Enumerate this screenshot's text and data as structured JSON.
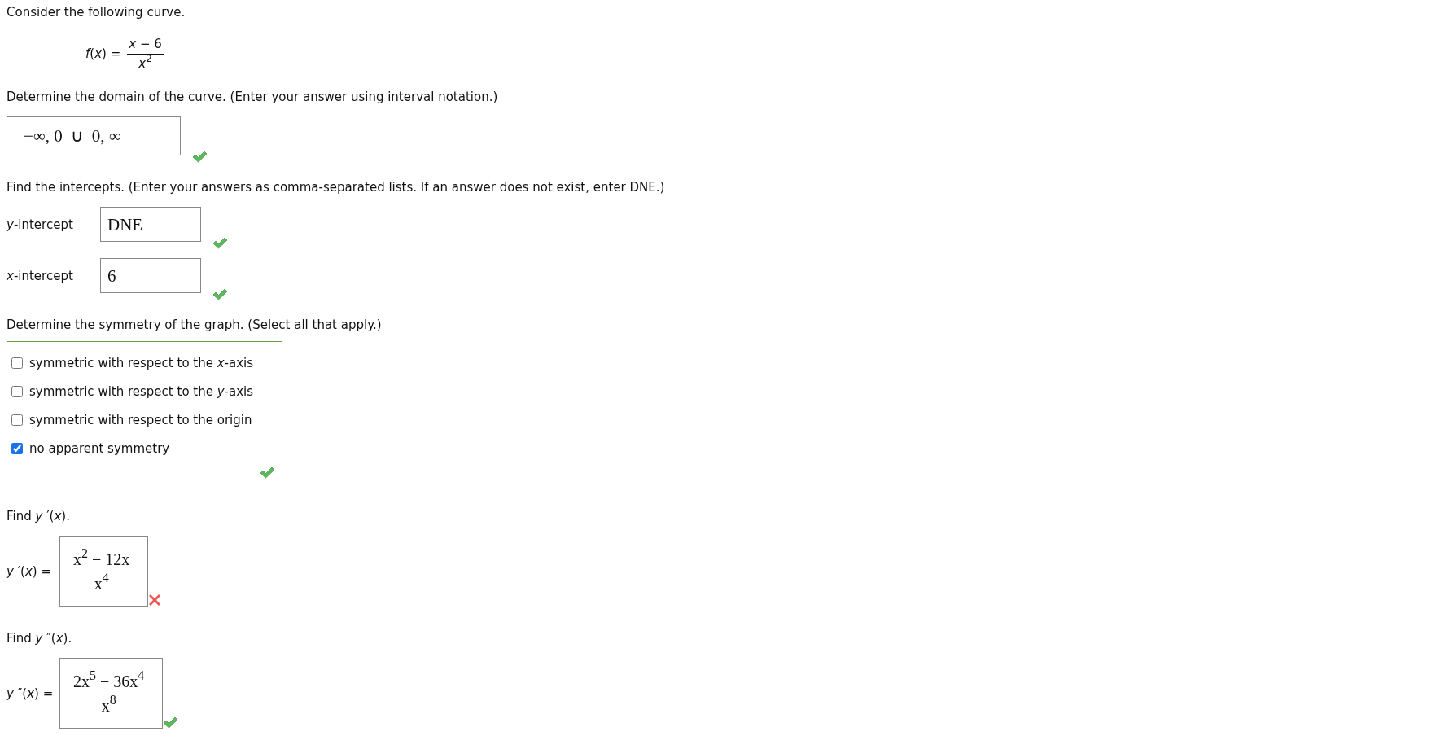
{
  "intro": "Consider the following curve.",
  "function": {
    "label": "*f*(*x*) =",
    "numerator": "*x* − 6",
    "denominator": "*x*$^{2}$"
  },
  "questions": [
    {
      "kind": "interval",
      "prompt": "Determine the domain of the curve. (Enter your answer using interval notation.)",
      "answer": "−∞, 0  ∪  0, ∞",
      "correct": true
    },
    {
      "kind": "fields",
      "prompt": "Find the intercepts. (Enter your answers as comma-separated lists. If an answer does not exist, enter DNE.)",
      "fields": [
        {
          "label": "*y*-intercept",
          "value": "DNE",
          "correct": true
        },
        {
          "label": "*x*-intercept",
          "value": "6",
          "correct": true
        }
      ]
    },
    {
      "kind": "checkboxes",
      "prompt": "Determine the symmetry of the graph. (Select all that apply.)",
      "correct": true,
      "options": [
        {
          "label": "symmetric with respect to the *x*-axis",
          "checked": false
        },
        {
          "label": "symmetric with respect to the *y*-axis",
          "checked": false
        },
        {
          "label": "symmetric with respect to the origin",
          "checked": false
        },
        {
          "label": "no apparent symmetry",
          "checked": true
        }
      ]
    },
    {
      "kind": "fraction",
      "prompt": "Find *y* ′(*x*).",
      "label": "*y* ′(*x*) =",
      "numerator": "x$^{2}$ − 12x",
      "denominator": "x$^{4}$",
      "correct": false
    },
    {
      "kind": "fraction",
      "prompt": "Find *y* ″(*x*).",
      "label": "*y* ″(*x*) =",
      "numerator": "2x$^{5}$ − 36x$^{4}$",
      "denominator": "x$^{8}$",
      "correct": true
    }
  ]
}
